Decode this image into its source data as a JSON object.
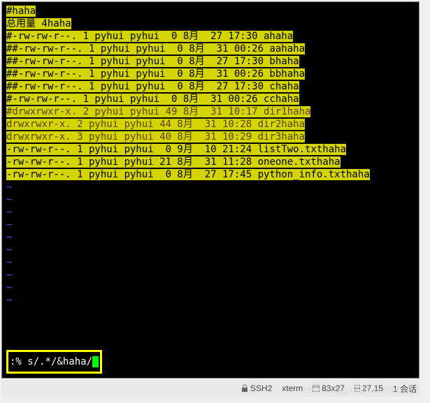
{
  "terminal": {
    "lines": [
      {
        "segments": [
          {
            "cls": "highlighted",
            "text": "#haha"
          }
        ]
      },
      {
        "segments": [
          {
            "cls": "highlighted",
            "text": "总用量 4haha"
          }
        ]
      },
      {
        "segments": [
          {
            "cls": "highlighted",
            "text": "#-rw-rw-r--. 1 pyhui pyhui  0 8月  27 17:30 ahaha"
          }
        ]
      },
      {
        "segments": [
          {
            "cls": "highlighted",
            "text": "##-rw-rw-r--. 1 pyhui pyhui  0 8月  31 00:26 aahaha"
          }
        ]
      },
      {
        "segments": [
          {
            "cls": "highlighted",
            "text": "##-rw-rw-r--. 1 pyhui pyhui  0 8月  27 17:30 bhaha"
          }
        ]
      },
      {
        "segments": [
          {
            "cls": "highlighted",
            "text": "##-rw-rw-r--. 1 pyhui pyhui  0 8月  31 00:26 bbhaha"
          }
        ]
      },
      {
        "segments": [
          {
            "cls": "highlighted",
            "text": "##-rw-rw-r--. 1 pyhui pyhui  0 8月  27 17:30 chaha"
          }
        ]
      },
      {
        "segments": [
          {
            "cls": "highlighted",
            "text": "#-rw-rw-r--. 1 pyhui pyhui  0 8月  31 00:26 cchaha"
          }
        ]
      },
      {
        "segments": [
          {
            "cls": "highlighted-brown",
            "text": "#drwxrwxr-x. 2 pyhui pyhui 49 8月  31 10:17 dir1haha"
          }
        ]
      },
      {
        "segments": [
          {
            "cls": "highlighted-brown",
            "text": "drwxrwxr-x. 2 pyhui pyhui 44 8月  31 10:28 dir2haha"
          }
        ]
      },
      {
        "segments": [
          {
            "cls": "highlighted-brown",
            "text": "drwxrwxr-x. 3 pyhui pyhui 40 8月  31 10:29 dir3haha"
          }
        ]
      },
      {
        "segments": [
          {
            "cls": "highlighted",
            "text": "-rw-rw-r--. 1 pyhui pyhui  0 9月  10 21:24 listTwo.txthaha"
          }
        ]
      },
      {
        "segments": [
          {
            "cls": "highlighted",
            "text": "-rw-rw-r--. 1 pyhui pyhui 21 8月  31 11:28 oneone.txthaha"
          }
        ]
      },
      {
        "segments": [
          {
            "cls": "highlighted",
            "text": "-rw-rw-r--. 1 pyhui pyhui  0 8月  27 17:45 python_info.txthaha"
          }
        ]
      }
    ],
    "tilde": "~",
    "tilde_count": 10,
    "command": ":% s/.*/&haha/"
  },
  "status": {
    "ssh": "SSH2",
    "term": "xterm",
    "size": "83x27",
    "pos": "27,15",
    "session": "1 会话"
  },
  "watermark": "https://blog.csdn.net/ifubing"
}
